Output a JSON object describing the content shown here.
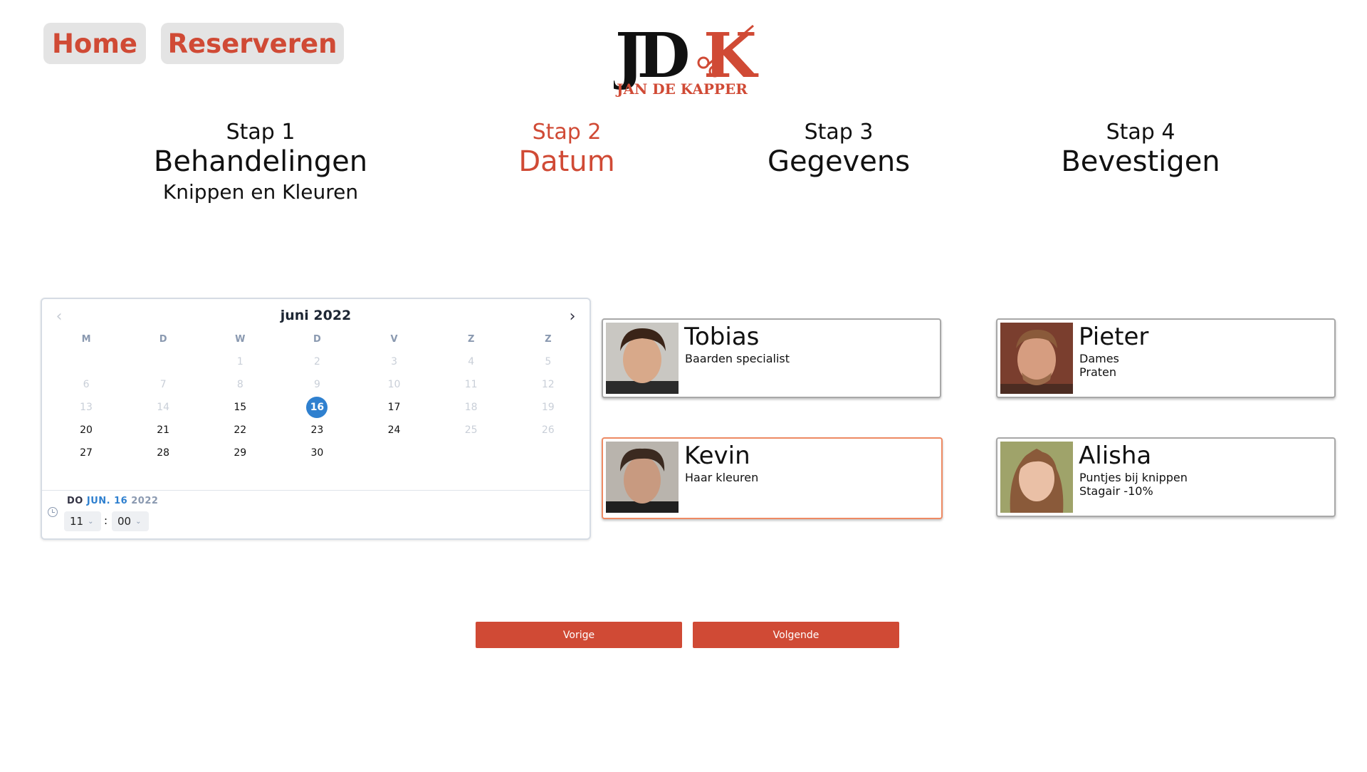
{
  "nav": {
    "home_label": "Home",
    "reserve_label": "Reserveren"
  },
  "logo": {
    "mark": "JDK",
    "name": "JAN DE KAPPER",
    "colors": {
      "dark": "#111111",
      "accent": "#d04a35"
    }
  },
  "steps": [
    {
      "number": "Stap 1",
      "title": "Behandelingen",
      "subtitle": "Knippen en Kleuren",
      "active": false
    },
    {
      "number": "Stap 2",
      "title": "Datum",
      "subtitle": "",
      "active": true
    },
    {
      "number": "Stap 3",
      "title": "Gegevens",
      "subtitle": "",
      "active": false
    },
    {
      "number": "Stap 4",
      "title": "Bevestigen",
      "subtitle": "",
      "active": false
    }
  ],
  "calendar": {
    "month_label": "juni 2022",
    "weekdays": [
      "M",
      "D",
      "W",
      "D",
      "V",
      "Z",
      "Z"
    ],
    "weeks": [
      [
        "",
        "",
        "1",
        "2",
        "3",
        "4",
        "5"
      ],
      [
        "6",
        "7",
        "8",
        "9",
        "10",
        "11",
        "12"
      ],
      [
        "13",
        "14",
        "15",
        "16",
        "17",
        "18",
        "19"
      ],
      [
        "20",
        "21",
        "22",
        "23",
        "24",
        "25",
        "26"
      ],
      [
        "27",
        "28",
        "29",
        "30",
        "",
        "",
        ""
      ]
    ],
    "enabled_days": [
      "15",
      "16",
      "17",
      "20",
      "21",
      "22",
      "23",
      "24",
      "27",
      "28",
      "29",
      "30"
    ],
    "selected_day": "16",
    "selected_date": {
      "weekday": "DO",
      "month_day": "JUN. 16",
      "year": "2022"
    },
    "time": {
      "hour": "11",
      "minute": "00",
      "separator": ":"
    },
    "accent": "#2f80cf"
  },
  "barbers": [
    {
      "name": "Tobias",
      "description": [
        "Baarden specialist"
      ],
      "selected": false
    },
    {
      "name": "Kevin",
      "description": [
        "Haar kleuren"
      ],
      "selected": true
    },
    {
      "name": "Pieter",
      "description": [
        "Dames",
        "Praten"
      ],
      "selected": false
    },
    {
      "name": "Alisha",
      "description": [
        "Puntjes bij knippen",
        "Stagair -10%"
      ],
      "selected": false
    }
  ],
  "actions": {
    "prev_label": "Vorige",
    "next_label": "Volgende"
  },
  "theme": {
    "brand": "#d04a35",
    "selected_border": "#ee8a63"
  }
}
